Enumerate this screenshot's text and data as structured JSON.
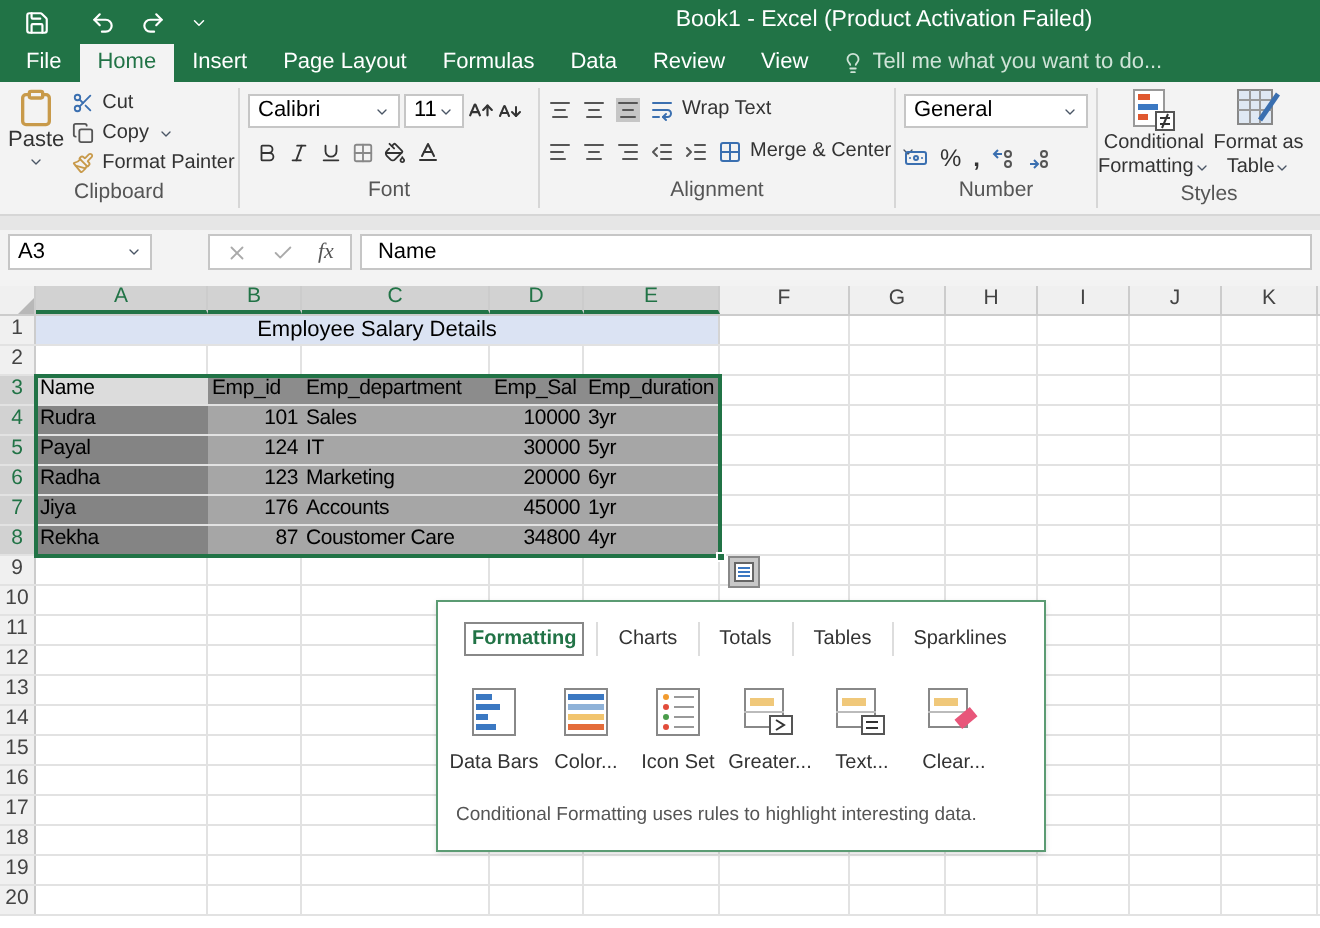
{
  "window": {
    "title": "Book1 - Excel (Product Activation Failed)"
  },
  "tabs": [
    {
      "label": "File",
      "selected": false
    },
    {
      "label": "Home",
      "selected": true
    },
    {
      "label": "Insert",
      "selected": false
    },
    {
      "label": "Page Layout",
      "selected": false
    },
    {
      "label": "Formulas",
      "selected": false
    },
    {
      "label": "Data",
      "selected": false
    },
    {
      "label": "Review",
      "selected": false
    },
    {
      "label": "View",
      "selected": false
    }
  ],
  "tell_me": {
    "placeholder": "Tell me what you want to do..."
  },
  "ribbon": {
    "clipboard": {
      "paste": "Paste",
      "cut": "Cut",
      "copy": "Copy",
      "format_painter": "Format Painter",
      "label": "Clipboard"
    },
    "font": {
      "font_name": "Calibri",
      "font_size": "11",
      "label": "Font"
    },
    "alignment": {
      "wrap_text": "Wrap Text",
      "merge_center": "Merge & Center",
      "label": "Alignment"
    },
    "number": {
      "format": "General",
      "percent": "%",
      "comma": ",",
      "label": "Number"
    },
    "styles": {
      "conditional_formatting": [
        "Conditional",
        "Formatting"
      ],
      "format_as_table": [
        "Format as",
        "Table"
      ],
      "label": "Styles"
    }
  },
  "formula_bar": {
    "name_box": "A3",
    "fx": "fx",
    "value": "Name"
  },
  "sheet": {
    "columns": [
      {
        "letter": "A",
        "selected": true
      },
      {
        "letter": "B",
        "selected": true
      },
      {
        "letter": "C",
        "selected": true
      },
      {
        "letter": "D",
        "selected": true
      },
      {
        "letter": "E",
        "selected": true
      },
      {
        "letter": "F",
        "selected": false
      },
      {
        "letter": "G",
        "selected": false
      },
      {
        "letter": "H",
        "selected": false
      },
      {
        "letter": "I",
        "selected": false
      },
      {
        "letter": "J",
        "selected": false
      },
      {
        "letter": "K",
        "selected": false
      }
    ],
    "rows": [
      {
        "number": "1",
        "selected": false
      },
      {
        "number": "2",
        "selected": false
      },
      {
        "number": "3",
        "selected": true
      },
      {
        "number": "4",
        "selected": true
      },
      {
        "number": "5",
        "selected": true
      },
      {
        "number": "6",
        "selected": true
      },
      {
        "number": "7",
        "selected": true
      },
      {
        "number": "8",
        "selected": true
      },
      {
        "number": "9",
        "selected": false
      },
      {
        "number": "10",
        "selected": false
      },
      {
        "number": "11",
        "selected": false
      },
      {
        "number": "12",
        "selected": false
      },
      {
        "number": "13",
        "selected": false
      },
      {
        "number": "14",
        "selected": false
      },
      {
        "number": "15",
        "selected": false
      },
      {
        "number": "16",
        "selected": false
      },
      {
        "number": "17",
        "selected": false
      },
      {
        "number": "18",
        "selected": false
      },
      {
        "number": "19",
        "selected": false
      },
      {
        "number": "20",
        "selected": false
      }
    ],
    "title": "Employee Salary Details",
    "table": {
      "columns": [
        {
          "header": "Name",
          "numeric": false
        },
        {
          "header": "Emp_id",
          "numeric": true
        },
        {
          "header": "Emp_department",
          "numeric": false
        },
        {
          "header": "Emp_Sal",
          "numeric": true
        },
        {
          "header": "Emp_duration",
          "numeric": false
        }
      ],
      "rows": [
        [
          "Rudra",
          "101",
          "Sales",
          "10000",
          "3yr"
        ],
        [
          "Payal",
          "124",
          "IT",
          "30000",
          "5yr"
        ],
        [
          "Radha",
          "123",
          "Marketing",
          "20000",
          "6yr"
        ],
        [
          "Jiya",
          "176",
          "Accounts",
          "45000",
          "1yr"
        ],
        [
          "Rekha",
          "87",
          "Coustomer Care",
          "34800",
          "4yr"
        ]
      ]
    }
  },
  "quick_analysis": {
    "tabs": [
      {
        "label": "Formatting",
        "selected": true
      },
      {
        "label": "Charts",
        "selected": false
      },
      {
        "label": "Totals",
        "selected": false
      },
      {
        "label": "Tables",
        "selected": false
      },
      {
        "label": "Sparklines",
        "selected": false
      }
    ],
    "items": [
      {
        "label": "Data Bars",
        "kind": "data_bars"
      },
      {
        "label": "Color...",
        "kind": "color_scale"
      },
      {
        "label": "Icon Set",
        "kind": "icon_set"
      },
      {
        "label": "Greater...",
        "kind": "greater"
      },
      {
        "label": "Text...",
        "kind": "text"
      },
      {
        "label": "Clear...",
        "kind": "clear"
      }
    ],
    "description": "Conditional Formatting uses rules to highlight interesting data."
  }
}
